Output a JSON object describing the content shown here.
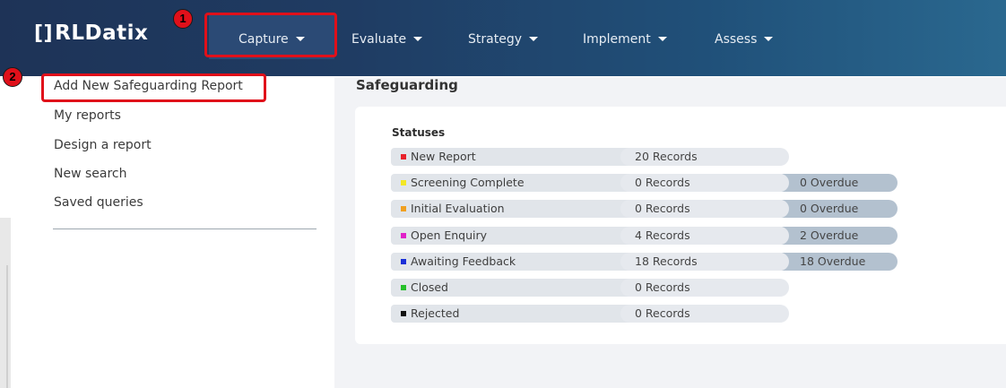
{
  "header": {
    "logo_text": "RLDatix",
    "nav": [
      {
        "label": "Capture"
      },
      {
        "label": "Evaluate"
      },
      {
        "label": "Strategy"
      },
      {
        "label": "Implement"
      },
      {
        "label": "Assess"
      }
    ]
  },
  "annotations": {
    "badge_1": "1",
    "badge_2": "2",
    "highlight_color": "#e0101a"
  },
  "sidebar": {
    "items": [
      {
        "label": "Add New Safeguarding Report"
      },
      {
        "label": "My reports"
      },
      {
        "label": "Design a report"
      },
      {
        "label": "New search"
      },
      {
        "label": "Saved queries"
      }
    ]
  },
  "main": {
    "title": "Safeguarding",
    "statuses_title": "Statuses",
    "statuses": [
      {
        "label": "New Report",
        "color": "#e8212a",
        "records": "20 Records",
        "overdue": ""
      },
      {
        "label": "Screening Complete",
        "color": "#f3e726",
        "records": "0 Records",
        "overdue": "0 Overdue"
      },
      {
        "label": "Initial Evaluation",
        "color": "#f0a020",
        "records": "0 Records",
        "overdue": "0 Overdue"
      },
      {
        "label": "Open Enquiry",
        "color": "#e020c8",
        "records": "4 Records",
        "overdue": "2 Overdue"
      },
      {
        "label": "Awaiting Feedback",
        "color": "#1a2fd8",
        "records": "18 Records",
        "overdue": "18 Overdue"
      },
      {
        "label": "Closed",
        "color": "#25c02a",
        "records": "0 Records",
        "overdue": ""
      },
      {
        "label": "Rejected",
        "color": "#111111",
        "records": "0 Records",
        "overdue": ""
      }
    ]
  }
}
